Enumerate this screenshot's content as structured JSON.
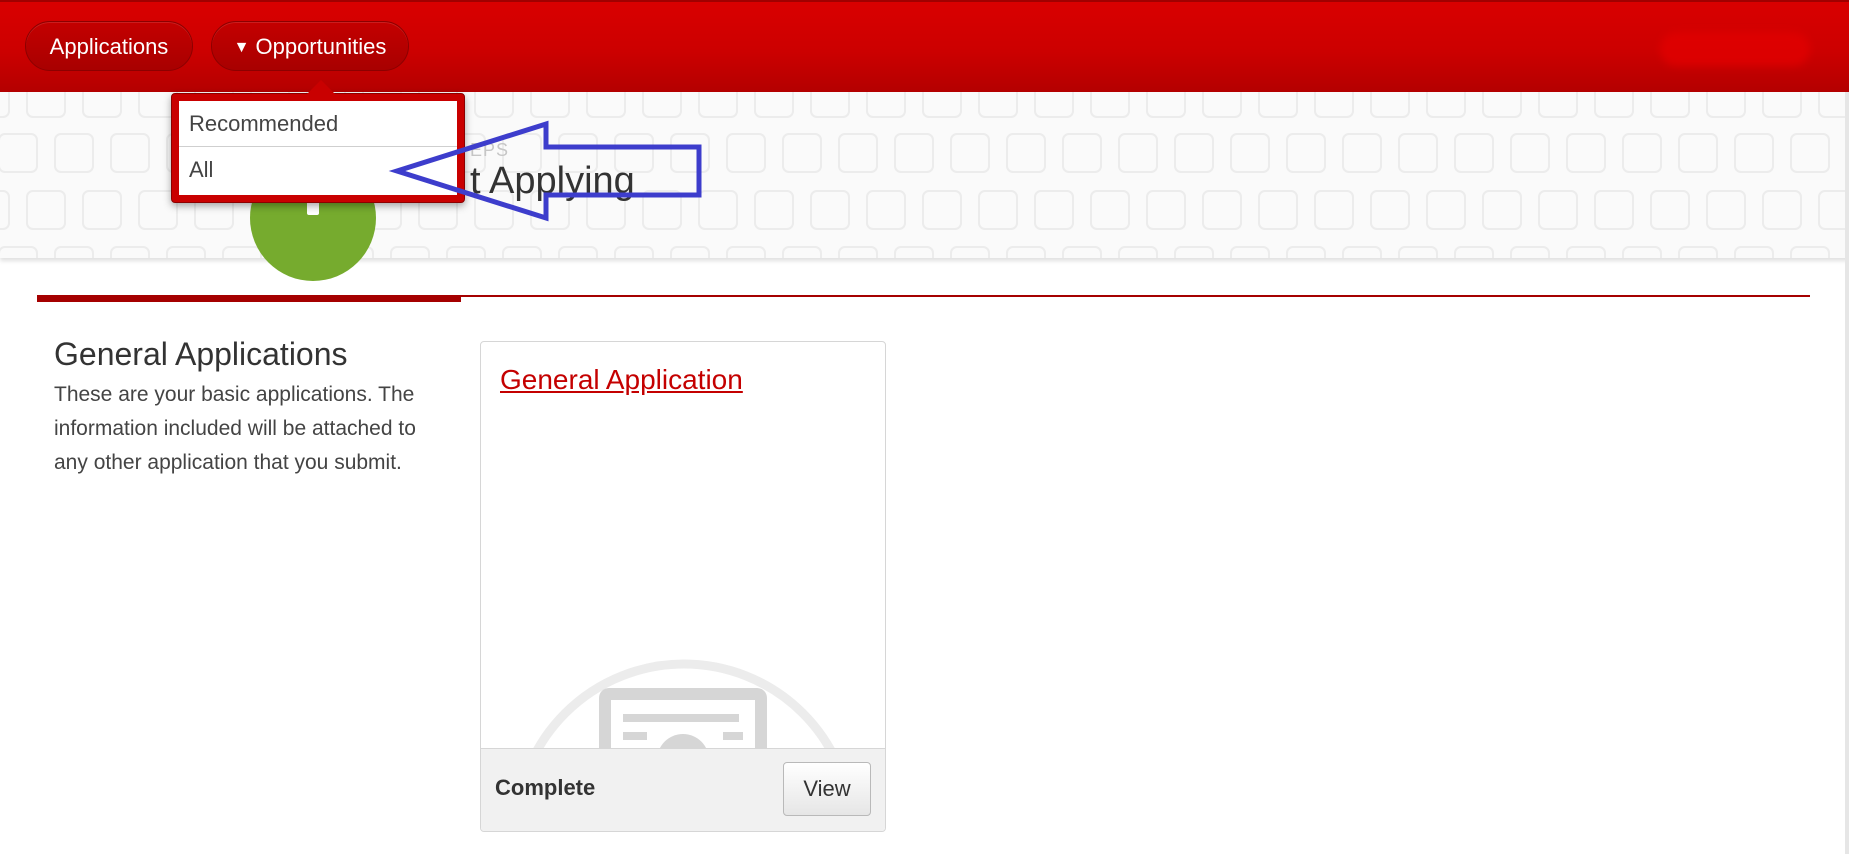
{
  "nav": {
    "applications_label": "Applications",
    "opportunities_label": "Opportunities",
    "caret_glyph": "▼"
  },
  "dropdown": {
    "items": [
      {
        "label": "Recommended"
      },
      {
        "label": "All"
      }
    ]
  },
  "hero": {
    "subtitle_fragment": "EPS",
    "title_fragment": "t Applying"
  },
  "section": {
    "title": "General Applications",
    "description": "These are your basic applications. The information included will be attached to any other application that you submit."
  },
  "card": {
    "link_label": "General Application",
    "status": "Complete",
    "view_label": "View"
  },
  "colors": {
    "brand_red": "#cc0000",
    "accent_green": "#76ab2e",
    "annotation_blue": "#3d3dcc"
  },
  "icons": {
    "card_art": "document-person-icon",
    "annotation": "arrow-left-annotation"
  }
}
